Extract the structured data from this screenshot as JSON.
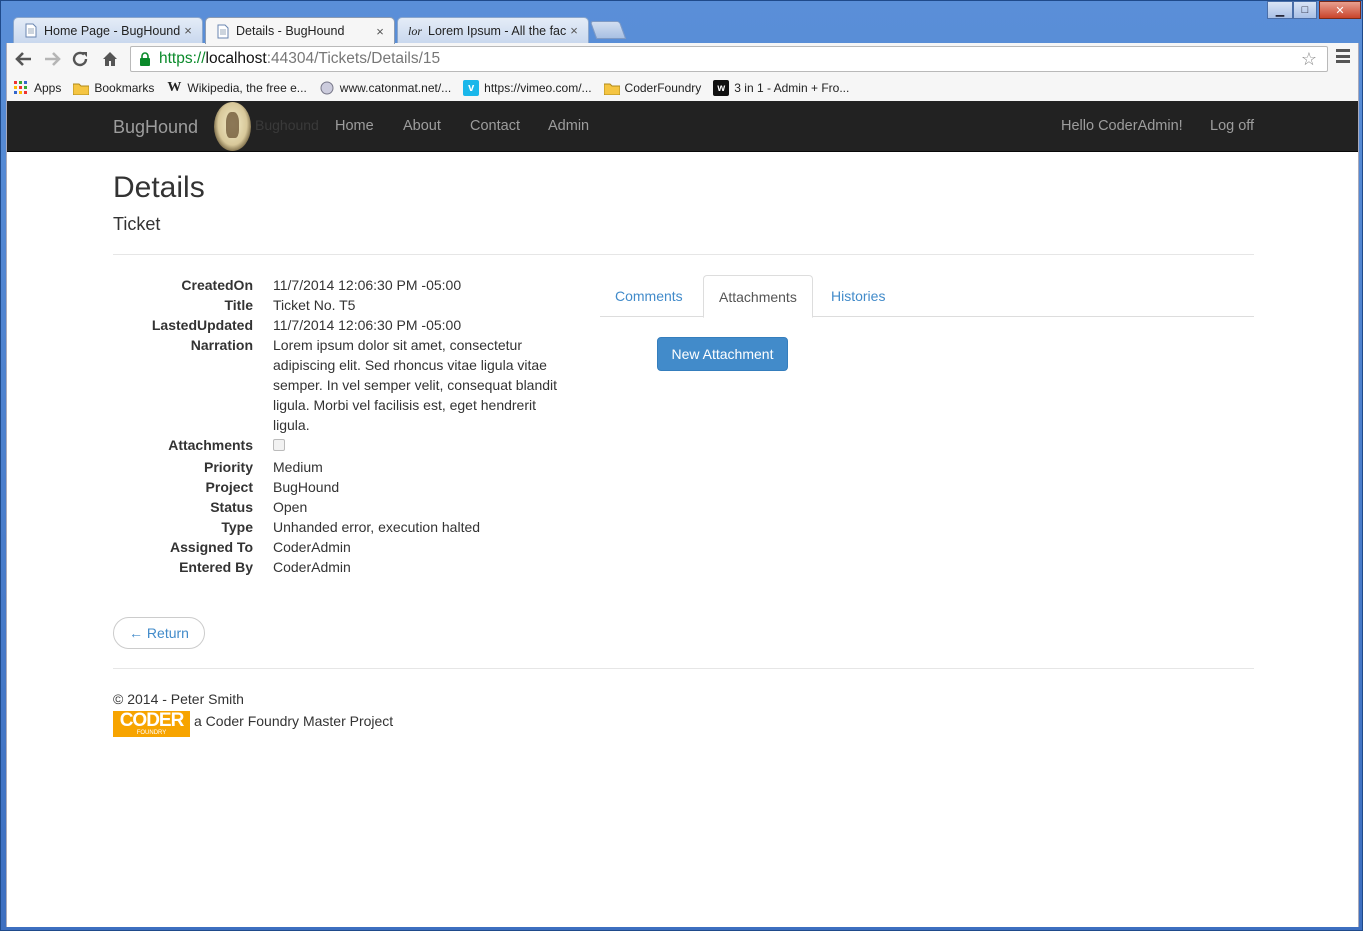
{
  "browser": {
    "tabs": [
      {
        "title": "Home Page - BugHound",
        "close": "×"
      },
      {
        "title": "Details - BugHound",
        "close": "×"
      },
      {
        "title": "Lorem Ipsum - All the fact",
        "close": "×"
      }
    ],
    "url": {
      "scheme": "https://",
      "host": "localhost",
      "path": ":44304/Tickets/Details/15"
    },
    "window_controls": {
      "minimize": "▁",
      "maximize": "□",
      "close": "✕"
    },
    "bookmarks": [
      {
        "label": "Apps",
        "icon": "apps-grid-icon"
      },
      {
        "label": "Bookmarks",
        "icon": "folder-icon"
      },
      {
        "label": "Wikipedia, the free e...",
        "icon": "wikipedia-icon"
      },
      {
        "label": "www.catonmat.net/...",
        "icon": "catonmat-icon"
      },
      {
        "label": "https://vimeo.com/...",
        "icon": "vimeo-icon"
      },
      {
        "label": "CoderFoundry",
        "icon": "folder-icon"
      },
      {
        "label": "3 in 1 - Admin + Fro...",
        "icon": "wrapbootstrap-icon"
      }
    ]
  },
  "navbar": {
    "brand": "BugHound",
    "brand_ghost": "Bughound",
    "links": [
      "Home",
      "About",
      "Contact",
      "Admin"
    ],
    "greeting": "Hello CoderAdmin!",
    "logoff": "Log off"
  },
  "page": {
    "title": "Details",
    "subtitle": "Ticket"
  },
  "details": [
    {
      "label": "CreatedOn",
      "value": "11/7/2014 12:06:30 PM -05:00"
    },
    {
      "label": "Title",
      "value": "Ticket No. T5"
    },
    {
      "label": "LastedUpdated",
      "value": "11/7/2014 12:06:30 PM -05:00"
    },
    {
      "label": "Narration",
      "value": "Lorem ipsum dolor sit amet, consectetur adipiscing elit. Sed rhoncus vitae ligula vitae semper. In vel semper velit, consequat blandit ligula. Morbi vel facilisis est, eget hendrerit ligula."
    },
    {
      "label": "Attachments",
      "value": ""
    },
    {
      "label": "Priority",
      "value": "Medium"
    },
    {
      "label": "Project",
      "value": "BugHound"
    },
    {
      "label": "Status",
      "value": "Open"
    },
    {
      "label": "Type",
      "value": "Unhanded error, execution halted"
    },
    {
      "label": "Assigned To",
      "value": "CoderAdmin"
    },
    {
      "label": "Entered By",
      "value": "CoderAdmin"
    }
  ],
  "attachments_checked": false,
  "tabs": [
    {
      "label": "Comments",
      "active": false
    },
    {
      "label": "Attachments",
      "active": true
    },
    {
      "label": "Histories",
      "active": false
    }
  ],
  "new_attachment_label": "New Attachment",
  "return_label": "← Return",
  "footer": {
    "copyright": "© 2014 - Peter Smith",
    "logo_text": "CODER",
    "logo_subtext": "FOUNDRY",
    "tagline": "a Coder Foundry Master Project"
  },
  "colors": {
    "primary": "#428bca",
    "navbar": "#222222",
    "coder_orange": "#f7a400"
  }
}
